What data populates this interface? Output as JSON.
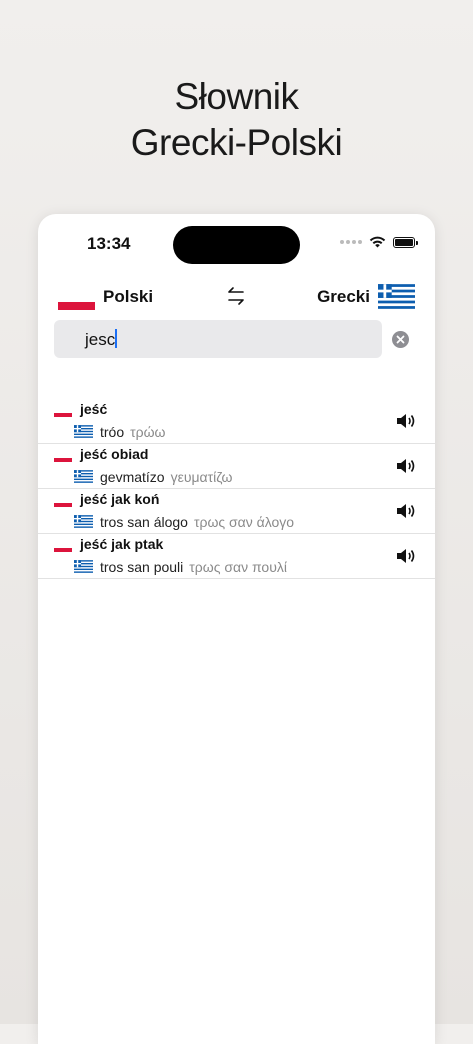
{
  "promo": {
    "title_line1": "Słownik",
    "title_line2": "Grecki-Polski"
  },
  "status_bar": {
    "time": "13:34"
  },
  "language_bar": {
    "source": "Polski",
    "target": "Grecki"
  },
  "search": {
    "value": "jesc"
  },
  "results": [
    {
      "term": "jeść",
      "transliteration": "tróo",
      "greek": "τρώω"
    },
    {
      "term": "jeść obiad",
      "transliteration": "gevmatízo",
      "greek": "γευματίζω"
    },
    {
      "term": "jeść jak koń",
      "transliteration": "tros san álogo",
      "greek": "τρως σαν άλογο"
    },
    {
      "term": "jeść jak ptak",
      "transliteration": "tros san pouli",
      "greek": "τρως σαν πουλί"
    }
  ],
  "colors": {
    "poland_red": "#dc143c",
    "greece_blue": "#0d5eaf",
    "caret_blue": "#1b6ff5"
  }
}
